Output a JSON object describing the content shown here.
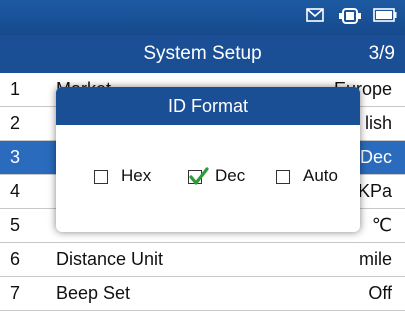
{
  "status": {
    "icons": [
      "mail-icon",
      "car-connection-icon",
      "battery-icon"
    ]
  },
  "header": {
    "title": "System Setup",
    "page": "3/9"
  },
  "list": {
    "rows": [
      {
        "num": "1",
        "name": "Market",
        "value": "Europe"
      },
      {
        "num": "2",
        "name": "",
        "value": "lish"
      },
      {
        "num": "3",
        "name": "",
        "value": "Dec"
      },
      {
        "num": "4",
        "name": "",
        "value": "KPa"
      },
      {
        "num": "5",
        "name": "",
        "value": "℃"
      },
      {
        "num": "6",
        "name": "Distance Unit",
        "value": "mile"
      },
      {
        "num": "7",
        "name": "Beep Set",
        "value": "Off"
      }
    ],
    "selected_index": 2
  },
  "dialog": {
    "title": "ID Format",
    "options": [
      {
        "label": "Hex",
        "checked": false
      },
      {
        "label": "Dec",
        "checked": true
      },
      {
        "label": "Auto",
        "checked": false
      }
    ]
  },
  "colors": {
    "header_blue": "#1b4f95",
    "selected_blue": "#2a6bbd",
    "check_green": "#2e9a3a"
  }
}
